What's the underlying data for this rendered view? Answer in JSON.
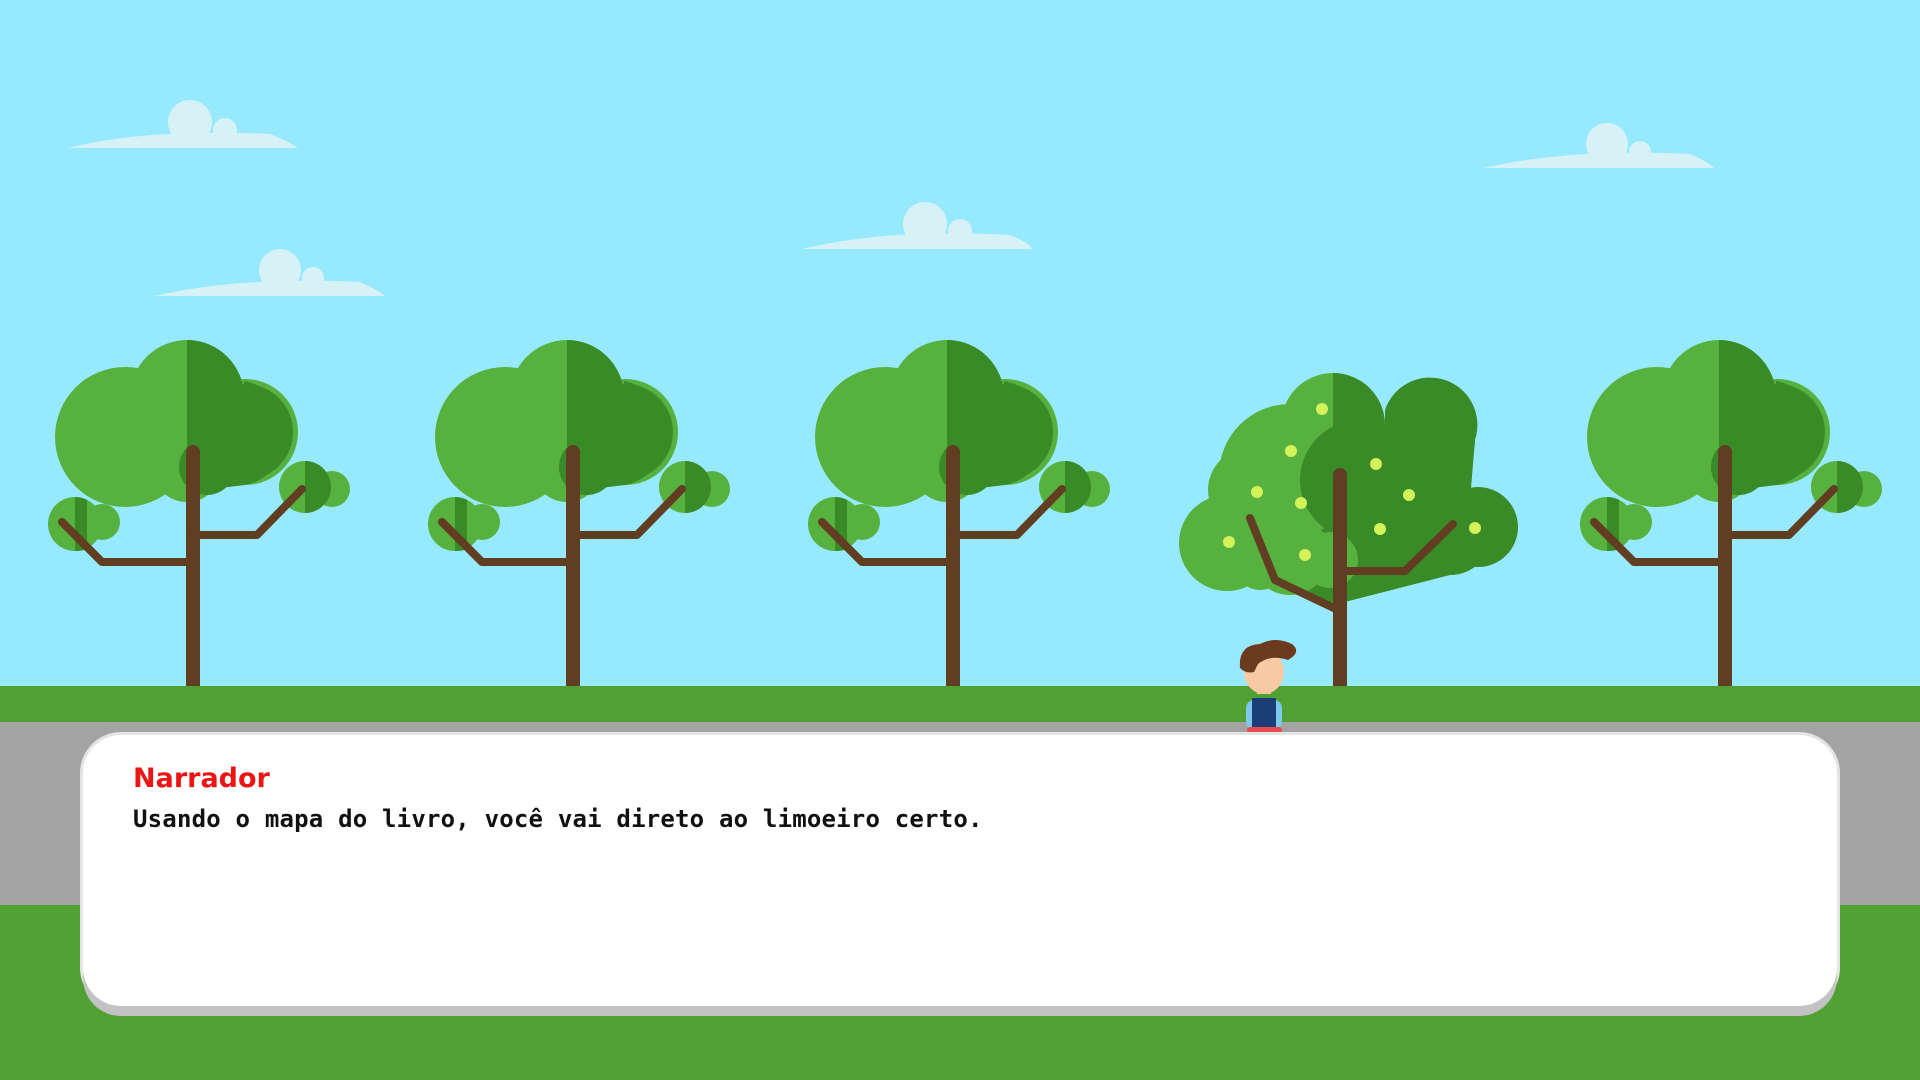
{
  "dialog": {
    "speaker": "Narrador",
    "text": "Usando o mapa do livro, você vai direto ao limoeiro certo."
  },
  "colors": {
    "sky": "#97eafe",
    "cloud": "#d7f2f6",
    "grass": "#50a034",
    "road": "#a3a3a3",
    "foliage_light": "#57b13e",
    "foliage_dark": "#398b27",
    "trunk": "#613d22",
    "lemon": "#d4f25a",
    "speaker_name": "#ec1515"
  },
  "scene": {
    "trees": [
      "tree",
      "tree",
      "tree",
      "lemon-tree",
      "tree"
    ],
    "character": "boy"
  }
}
